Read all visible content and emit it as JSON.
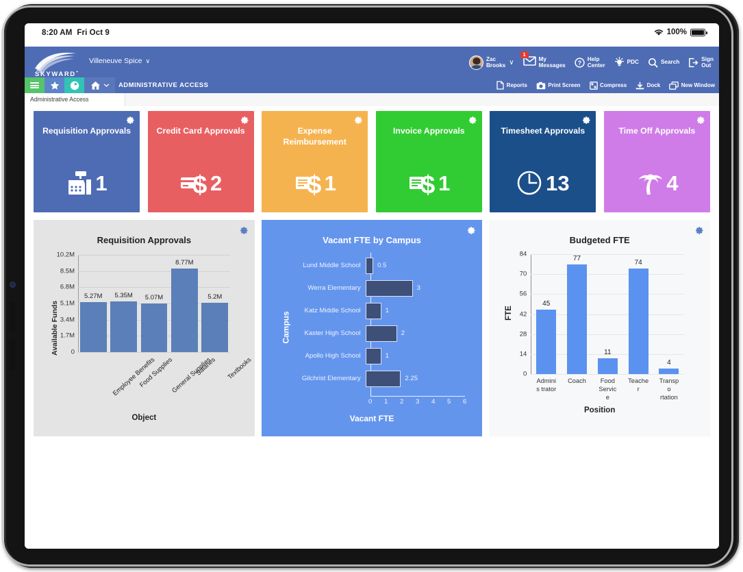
{
  "status_bar": {
    "time": "8:20 AM",
    "date": "Fri Oct 9",
    "battery_pct": "100%",
    "wifi_icon": "wifi-icon",
    "battery_icon": "battery-icon"
  },
  "top_nav": {
    "logo_text": "SKYWARD",
    "district": "Villeneuve Spice",
    "district_caret": "∨",
    "items": [
      {
        "label": "Zac\nBrooks",
        "icon": "user-avatar",
        "caret": "∨"
      },
      {
        "label": "My\nMessages",
        "icon": "envelope-icon",
        "badge": "1"
      },
      {
        "label": "Help\nCenter",
        "icon": "question-circle-icon"
      },
      {
        "label": "PDC",
        "icon": "lightbulb-icon"
      },
      {
        "label": "Search",
        "icon": "magnifier-icon"
      },
      {
        "label": "Sign\nOut",
        "icon": "signout-icon"
      }
    ]
  },
  "module_bar": {
    "title": "ADMINISTRATIVE ACCESS",
    "left_buttons": [
      {
        "name": "menu",
        "icon": "hamburger-icon",
        "color": "#56c46a"
      },
      {
        "name": "favorites",
        "icon": "star-icon",
        "color": "#5b84cb"
      },
      {
        "name": "recent",
        "icon": "clock-circle-icon",
        "color": "#32c3b4"
      },
      {
        "name": "home",
        "icon": "home-icon",
        "color": "#5a77bb"
      }
    ],
    "right_items": [
      {
        "label": "Reports",
        "icon": "document-icon"
      },
      {
        "label": "Print Screen",
        "icon": "camera-icon"
      },
      {
        "label": "Compress",
        "icon": "compress-icon"
      },
      {
        "label": "Dock",
        "icon": "dock-down-icon"
      },
      {
        "label": "New Window",
        "icon": "new-window-icon"
      }
    ]
  },
  "breadcrumb": {
    "text": "Administrative Access"
  },
  "tiles": [
    {
      "title": "Requisition Approvals",
      "count": "1",
      "color": "#4e6cb4",
      "icon": "cash-register-icon",
      "gear": "gear-icon"
    },
    {
      "title": "Credit Card Approvals",
      "count": "2",
      "color": "#e85f62",
      "icon": "credit-card-dollar-icon",
      "gear": "gear-icon"
    },
    {
      "title": "Expense Reimbursement",
      "count": "1",
      "color": "#f5b350",
      "icon": "invoice-dollar-icon",
      "gear": "gear-icon"
    },
    {
      "title": "Invoice Approvals",
      "count": "1",
      "color": "#31cc33",
      "icon": "invoice-dollar-icon",
      "gear": "gear-icon"
    },
    {
      "title": "Timesheet Approvals",
      "count": "13",
      "color": "#1b4f8a",
      "icon": "clock-icon",
      "gear": "gear-icon"
    },
    {
      "title": "Time Off Approvals",
      "count": "4",
      "color": "#d07ce8",
      "icon": "palm-tree-icon",
      "gear": "gear-icon"
    }
  ],
  "chart_data": [
    {
      "type": "bar",
      "title": "Requisition Approvals",
      "xlabel": "Object",
      "ylabel": "Available Funds",
      "categories": [
        "Employee Benefits",
        "Food Supplies",
        "General Supplies",
        "Salaries",
        "Textbooks"
      ],
      "values": [
        5270000,
        5350000,
        5070000,
        8770000,
        5200000
      ],
      "value_labels": [
        "5.27M",
        "5.35M",
        "5.07M",
        "8.77M",
        "5.2M"
      ],
      "yticks": [
        0,
        1700000,
        3400000,
        5100000,
        6800000,
        8500000,
        10200000
      ],
      "ytick_labels": [
        "0",
        "1.7M",
        "3.4M",
        "5.1M",
        "6.8M",
        "8.5M",
        "10.2M"
      ],
      "ylim": [
        0,
        10200000
      ],
      "grid": true,
      "legend": "none",
      "bar_color": "#5b7fb8",
      "card_bg": "#e4e4e4"
    },
    {
      "type": "bar",
      "orientation": "horizontal",
      "title": "Vacant FTE by Campus",
      "xlabel": "Vacant FTE",
      "ylabel": "Campus",
      "categories": [
        "Lund Middle School",
        "Werra Elementary",
        "Katz  Middle School",
        "Kaster High School",
        "Apollo High School",
        "Gilchrist Elementary"
      ],
      "values": [
        0.5,
        3,
        1,
        2,
        1,
        2.25
      ],
      "value_labels": [
        "0.5",
        "3",
        "1",
        "2",
        "1",
        "2.25"
      ],
      "xticks": [
        0,
        1,
        2,
        3,
        4,
        5,
        6
      ],
      "xtick_labels": [
        "0",
        "1",
        "2",
        "3",
        "4",
        "5",
        "6"
      ],
      "xlim": [
        0,
        6
      ],
      "grid": false,
      "legend": "none",
      "bar_color": "#3e4f78",
      "card_bg": "#6495ed"
    },
    {
      "type": "bar",
      "title": "Budgeted FTE",
      "xlabel": "Position",
      "ylabel": "FTE",
      "categories": [
        "Adminis trator",
        "Coach",
        "Food Service",
        "Teacher",
        "Transpo rtation"
      ],
      "values": [
        45,
        77,
        11,
        74,
        4
      ],
      "value_labels": [
        "45",
        "77",
        "11",
        "74",
        "4"
      ],
      "yticks": [
        0,
        14,
        28,
        42,
        56,
        70,
        84
      ],
      "ytick_labels": [
        "0",
        "14",
        "28",
        "42",
        "56",
        "70",
        "84"
      ],
      "ylim": [
        0,
        84
      ],
      "grid": true,
      "legend": "none",
      "bar_color": "#5b92f0",
      "card_bg": "#f7f8f9"
    }
  ]
}
